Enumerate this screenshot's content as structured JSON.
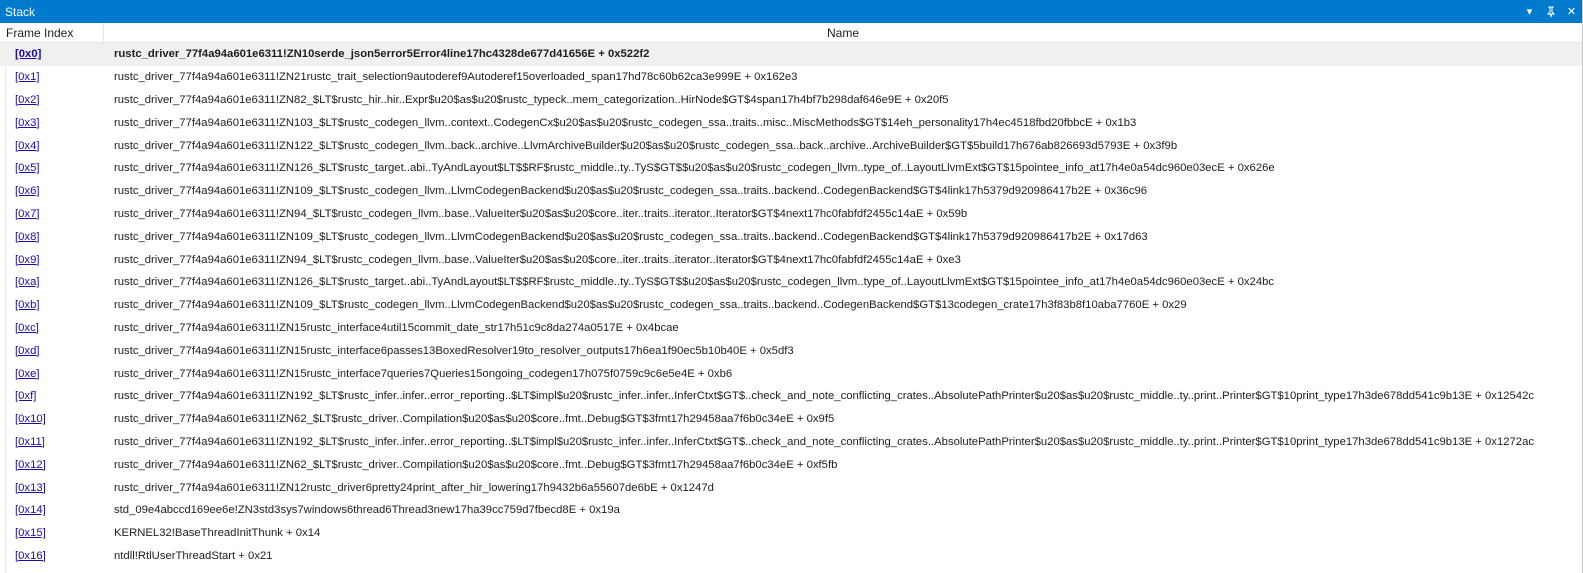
{
  "window": {
    "title": "Stack",
    "controls": {
      "dropdown": "▾",
      "pin": "⊥",
      "close": "✕"
    }
  },
  "columns": {
    "index": "Frame Index",
    "name": "Name"
  },
  "frames": [
    {
      "index": "[0x0]",
      "name": "rustc_driver_77f4a94a601e6311!ZN10serde_json5error5Error4line17hc4328de677d41656E + 0x522f2",
      "current": true
    },
    {
      "index": "[0x1]",
      "name": "rustc_driver_77f4a94a601e6311!ZN21rustc_trait_selection9autoderef9Autoderef15overloaded_span17hd78c60b62ca3e999E + 0x162e3"
    },
    {
      "index": "[0x2]",
      "name": "rustc_driver_77f4a94a601e6311!ZN82_$LT$rustc_hir..hir..Expr$u20$as$u20$rustc_typeck..mem_categorization..HirNode$GT$4span17h4bf7b298daf646e9E + 0x20f5"
    },
    {
      "index": "[0x3]",
      "name": "rustc_driver_77f4a94a601e6311!ZN103_$LT$rustc_codegen_llvm..context..CodegenCx$u20$as$u20$rustc_codegen_ssa..traits..misc..MiscMethods$GT$14eh_personality17h4ec4518fbd20fbbcE + 0x1b3"
    },
    {
      "index": "[0x4]",
      "name": "rustc_driver_77f4a94a601e6311!ZN122_$LT$rustc_codegen_llvm..back..archive..LlvmArchiveBuilder$u20$as$u20$rustc_codegen_ssa..back..archive..ArchiveBuilder$GT$5build17h676ab826693d5793E + 0x3f9b"
    },
    {
      "index": "[0x5]",
      "name": "rustc_driver_77f4a94a601e6311!ZN126_$LT$rustc_target..abi..TyAndLayout$LT$$RF$rustc_middle..ty..TyS$GT$$u20$as$u20$rustc_codegen_llvm..type_of..LayoutLlvmExt$GT$15pointee_info_at17h4e0a54dc960e03ecE + 0x626e"
    },
    {
      "index": "[0x6]",
      "name": "rustc_driver_77f4a94a601e6311!ZN109_$LT$rustc_codegen_llvm..LlvmCodegenBackend$u20$as$u20$rustc_codegen_ssa..traits..backend..CodegenBackend$GT$4link17h5379d920986417b2E + 0x36c96"
    },
    {
      "index": "[0x7]",
      "name": "rustc_driver_77f4a94a601e6311!ZN94_$LT$rustc_codegen_llvm..base..ValueIter$u20$as$u20$core..iter..traits..iterator..Iterator$GT$4next17hc0fabfdf2455c14aE + 0x59b"
    },
    {
      "index": "[0x8]",
      "name": "rustc_driver_77f4a94a601e6311!ZN109_$LT$rustc_codegen_llvm..LlvmCodegenBackend$u20$as$u20$rustc_codegen_ssa..traits..backend..CodegenBackend$GT$4link17h5379d920986417b2E + 0x17d63"
    },
    {
      "index": "[0x9]",
      "name": "rustc_driver_77f4a94a601e6311!ZN94_$LT$rustc_codegen_llvm..base..ValueIter$u20$as$u20$core..iter..traits..iterator..Iterator$GT$4next17hc0fabfdf2455c14aE + 0xe3"
    },
    {
      "index": "[0xa]",
      "name": "rustc_driver_77f4a94a601e6311!ZN126_$LT$rustc_target..abi..TyAndLayout$LT$$RF$rustc_middle..ty..TyS$GT$$u20$as$u20$rustc_codegen_llvm..type_of..LayoutLlvmExt$GT$15pointee_info_at17h4e0a54dc960e03ecE + 0x24bc"
    },
    {
      "index": "[0xb]",
      "name": "rustc_driver_77f4a94a601e6311!ZN109_$LT$rustc_codegen_llvm..LlvmCodegenBackend$u20$as$u20$rustc_codegen_ssa..traits..backend..CodegenBackend$GT$13codegen_crate17h3f83b8f10aba7760E + 0x29"
    },
    {
      "index": "[0xc]",
      "name": "rustc_driver_77f4a94a601e6311!ZN15rustc_interface4util15commit_date_str17h51c9c8da274a0517E + 0x4bcae"
    },
    {
      "index": "[0xd]",
      "name": "rustc_driver_77f4a94a601e6311!ZN15rustc_interface6passes13BoxedResolver19to_resolver_outputs17h6ea1f90ec5b10b40E + 0x5df3"
    },
    {
      "index": "[0xe]",
      "name": "rustc_driver_77f4a94a601e6311!ZN15rustc_interface7queries7Queries15ongoing_codegen17h075f0759c9c6e5e4E + 0xb6"
    },
    {
      "index": "[0xf]",
      "name": "rustc_driver_77f4a94a601e6311!ZN192_$LT$rustc_infer..infer..error_reporting..$LT$impl$u20$rustc_infer..infer..InferCtxt$GT$..check_and_note_conflicting_crates..AbsolutePathPrinter$u20$as$u20$rustc_middle..ty..print..Printer$GT$10print_type17h3de678dd541c9b13E + 0x12542c"
    },
    {
      "index": "[0x10]",
      "name": "rustc_driver_77f4a94a601e6311!ZN62_$LT$rustc_driver..Compilation$u20$as$u20$core..fmt..Debug$GT$3fmt17h29458aa7f6b0c34eE + 0x9f5"
    },
    {
      "index": "[0x11]",
      "name": "rustc_driver_77f4a94a601e6311!ZN192_$LT$rustc_infer..infer..error_reporting..$LT$impl$u20$rustc_infer..infer..InferCtxt$GT$..check_and_note_conflicting_crates..AbsolutePathPrinter$u20$as$u20$rustc_middle..ty..print..Printer$GT$10print_type17h3de678dd541c9b13E + 0x1272ac"
    },
    {
      "index": "[0x12]",
      "name": "rustc_driver_77f4a94a601e6311!ZN62_$LT$rustc_driver..Compilation$u20$as$u20$core..fmt..Debug$GT$3fmt17h29458aa7f6b0c34eE + 0xf5fb"
    },
    {
      "index": "[0x13]",
      "name": "rustc_driver_77f4a94a601e6311!ZN12rustc_driver6pretty24print_after_hir_lowering17h9432b6a55607de6bE + 0x1247d"
    },
    {
      "index": "[0x14]",
      "name": "std_09e4abccd169ee6e!ZN3std3sys7windows6thread6Thread3new17ha39cc759d7fbecd8E + 0x19a"
    },
    {
      "index": "[0x15]",
      "name": "KERNEL32!BaseThreadInitThunk + 0x14"
    },
    {
      "index": "[0x16]",
      "name": "ntdll!RtlUserThreadStart + 0x21"
    }
  ]
}
